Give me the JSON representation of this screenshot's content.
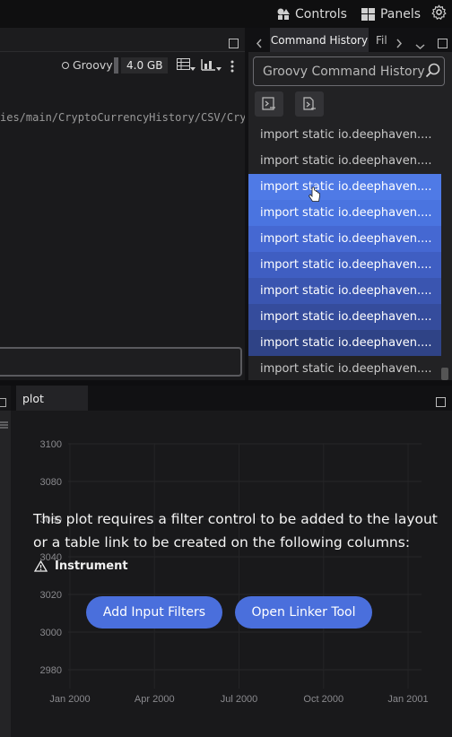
{
  "topbar": {
    "controls_label": "Controls",
    "panels_label": "Panels",
    "icons": [
      "shapes-icon",
      "panels-icon",
      "gear-icon"
    ]
  },
  "code_panel": {
    "language": "Groovy",
    "heap": "4.0 GB",
    "path_text": "ies/main/CryptoCurrencyHistory/CSV/Cry",
    "icons": [
      "table-icon",
      "chart-icon",
      "more-vertical-icon",
      "maximize-icon"
    ]
  },
  "command_history": {
    "tab_active": "Command History",
    "tab_inactive": "Fil",
    "search_placeholder": "Groovy Command History",
    "selection_color": "#4a6fdc",
    "items": [
      {
        "text": "import static io.deephaven....",
        "selected": false
      },
      {
        "text": "import static io.deephaven....",
        "selected": false
      },
      {
        "text": "import static io.deephaven....",
        "selected": true
      },
      {
        "text": "import static io.deephaven....",
        "selected": true
      },
      {
        "text": "import static io.deephaven....",
        "selected": true
      },
      {
        "text": "import static io.deephaven....",
        "selected": true
      },
      {
        "text": "import static io.deephaven....",
        "selected": true
      },
      {
        "text": "import static io.deephaven....",
        "selected": true
      },
      {
        "text": "import static io.deephaven....",
        "selected": true
      },
      {
        "text": "import static io.deephaven....",
        "selected": false
      }
    ]
  },
  "plot_panel": {
    "tab_label": "plot",
    "message": "This plot requires a filter control to be added to the layout or a table link to be created on the following columns:",
    "column": "Instrument",
    "add_filters_label": "Add Input Filters",
    "linker_label": "Open Linker Tool"
  },
  "chart_data": {
    "type": "line",
    "y_ticks": [
      "3100",
      "3080",
      "3060",
      "3040",
      "3020",
      "3000",
      "2980"
    ],
    "x_ticks": [
      "Jan 2000",
      "Apr 2000",
      "Jul 2000",
      "Oct 2000",
      "Jan 2001"
    ],
    "series": [],
    "ylim": [
      2970,
      3100
    ],
    "grid": true
  }
}
